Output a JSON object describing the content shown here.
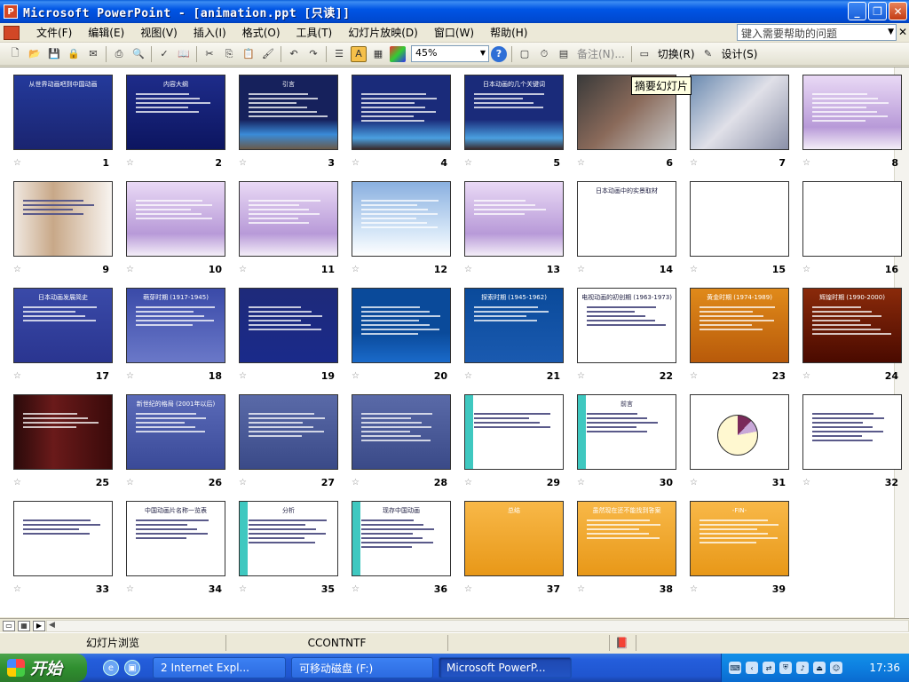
{
  "window": {
    "title": "Microsoft PowerPoint - [animation.ppt [只读]]",
    "app_icon_letter": "P",
    "controls": {
      "minimize": "_",
      "restore": "❐",
      "close": "✕"
    }
  },
  "menubar": {
    "items": [
      "文件(F)",
      "编辑(E)",
      "视图(V)",
      "插入(I)",
      "格式(O)",
      "工具(T)",
      "幻灯片放映(D)",
      "窗口(W)",
      "帮助(H)"
    ],
    "help_placeholder": "键入需要帮助的问题",
    "close_glyph": "✕"
  },
  "toolbar": {
    "zoom": "45%",
    "notes_label": "备注(N)...",
    "transition_label": "切换(R)",
    "design_label": "设计(S)"
  },
  "tooltip": "摘要幻灯片",
  "slides": [
    {
      "n": "1",
      "title": "从世界动画吧到中国动画"
    },
    {
      "n": "2",
      "title": "内容大纲"
    },
    {
      "n": "3",
      "title": "引言"
    },
    {
      "n": "4",
      "title": ""
    },
    {
      "n": "5",
      "title": "日本动画的几个关键词"
    },
    {
      "n": "6",
      "title": ""
    },
    {
      "n": "7",
      "title": ""
    },
    {
      "n": "8",
      "title": ""
    },
    {
      "n": "9",
      "title": ""
    },
    {
      "n": "10",
      "title": ""
    },
    {
      "n": "11",
      "title": ""
    },
    {
      "n": "12",
      "title": ""
    },
    {
      "n": "13",
      "title": ""
    },
    {
      "n": "14",
      "title": "日本动画中的实景取材"
    },
    {
      "n": "15",
      "title": ""
    },
    {
      "n": "16",
      "title": ""
    },
    {
      "n": "17",
      "title": "日本动画发展简史"
    },
    {
      "n": "18",
      "title": "萌芽时期 (1917-1945)"
    },
    {
      "n": "19",
      "title": ""
    },
    {
      "n": "20",
      "title": ""
    },
    {
      "n": "21",
      "title": "探索时期 (1945-1962)"
    },
    {
      "n": "22",
      "title": "电视动画的初创期 (1963-1973)"
    },
    {
      "n": "23",
      "title": "黄金时期 (1974-1989)"
    },
    {
      "n": "24",
      "title": "辉煌时期 (1990-2000)"
    },
    {
      "n": "25",
      "title": ""
    },
    {
      "n": "26",
      "title": "新世纪的格局 (2001年以后)"
    },
    {
      "n": "27",
      "title": ""
    },
    {
      "n": "28",
      "title": ""
    },
    {
      "n": "29",
      "title": ""
    },
    {
      "n": "30",
      "title": "前言"
    },
    {
      "n": "31",
      "title": ""
    },
    {
      "n": "32",
      "title": ""
    },
    {
      "n": "33",
      "title": ""
    },
    {
      "n": "34",
      "title": "中国动画片名称一览表"
    },
    {
      "n": "35",
      "title": "分析"
    },
    {
      "n": "36",
      "title": "现存中国动画"
    },
    {
      "n": "37",
      "title": "总结"
    },
    {
      "n": "38",
      "title": "虽然现在还不能找到答案"
    },
    {
      "n": "39",
      "title": "-FIN-"
    }
  ],
  "status": {
    "view": "幻灯片浏览",
    "design": "CCONTNTF"
  },
  "taskbar": {
    "start": "开始",
    "tasks": [
      "2 Internet Expl...",
      "可移动磁盘 (F:)",
      "Microsoft PowerP..."
    ],
    "clock": "17:36"
  }
}
